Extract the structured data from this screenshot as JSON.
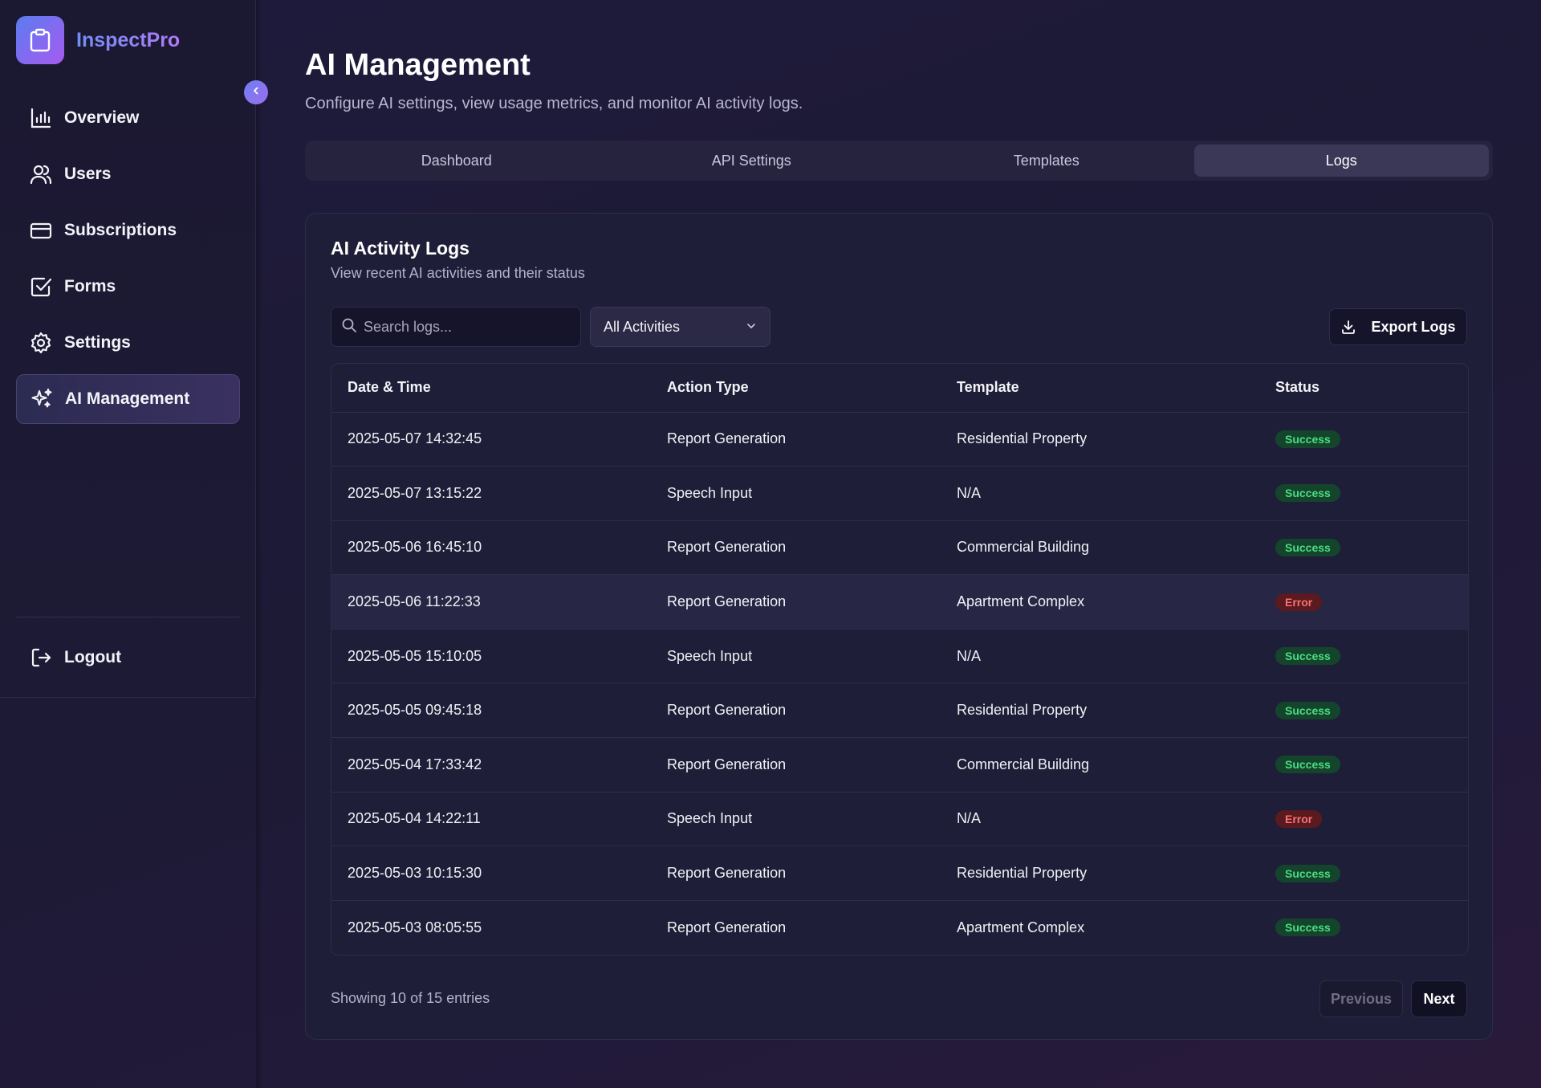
{
  "brand": {
    "name": "InspectPro",
    "logo_icon": "clipboard-icon"
  },
  "sidebar": {
    "items": [
      {
        "label": "Overview",
        "icon": "bar-chart-icon"
      },
      {
        "label": "Users",
        "icon": "users-icon"
      },
      {
        "label": "Subscriptions",
        "icon": "credit-card-icon"
      },
      {
        "label": "Forms",
        "icon": "check-square-icon"
      },
      {
        "label": "Settings",
        "icon": "gear-icon"
      },
      {
        "label": "AI Management",
        "icon": "sparkles-icon",
        "active": true
      }
    ],
    "logout_label": "Logout"
  },
  "header": {
    "title": "AI Management",
    "subtitle": "Configure AI settings, view usage metrics, and monitor AI activity logs."
  },
  "tabs": [
    {
      "label": "Dashboard"
    },
    {
      "label": "API Settings"
    },
    {
      "label": "Templates"
    },
    {
      "label": "Logs",
      "active": true
    }
  ],
  "logs": {
    "title": "AI Activity Logs",
    "subtitle": "View recent AI activities and their status",
    "search_placeholder": "Search logs...",
    "filter_value": "All Activities",
    "export_label": "Export Logs",
    "columns": [
      "Date & Time",
      "Action Type",
      "Template",
      "Status"
    ],
    "rows": [
      {
        "datetime": "2025-05-07 14:32:45",
        "action": "Report Generation",
        "template": "Residential Property",
        "status": "Success"
      },
      {
        "datetime": "2025-05-07 13:15:22",
        "action": "Speech Input",
        "template": "N/A",
        "status": "Success"
      },
      {
        "datetime": "2025-05-06 16:45:10",
        "action": "Report Generation",
        "template": "Commercial Building",
        "status": "Success"
      },
      {
        "datetime": "2025-05-06 11:22:33",
        "action": "Report Generation",
        "template": "Apartment Complex",
        "status": "Error"
      },
      {
        "datetime": "2025-05-05 15:10:05",
        "action": "Speech Input",
        "template": "N/A",
        "status": "Success"
      },
      {
        "datetime": "2025-05-05 09:45:18",
        "action": "Report Generation",
        "template": "Residential Property",
        "status": "Success"
      },
      {
        "datetime": "2025-05-04 17:33:42",
        "action": "Report Generation",
        "template": "Commercial Building",
        "status": "Success"
      },
      {
        "datetime": "2025-05-04 14:22:11",
        "action": "Speech Input",
        "template": "N/A",
        "status": "Error"
      },
      {
        "datetime": "2025-05-03 10:15:30",
        "action": "Report Generation",
        "template": "Residential Property",
        "status": "Success"
      },
      {
        "datetime": "2025-05-03 08:05:55",
        "action": "Report Generation",
        "template": "Apartment Complex",
        "status": "Success"
      }
    ],
    "footer": "Showing 10 of 15 entries",
    "prev_label": "Previous",
    "next_label": "Next"
  },
  "colors": {
    "accent_gradient_start": "#5b7cf0",
    "accent_gradient_end": "#a65bf0",
    "success": "#4ade80",
    "error": "#f87171"
  }
}
